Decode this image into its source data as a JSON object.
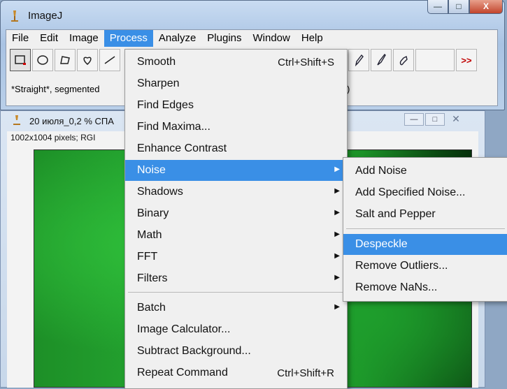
{
  "main_window": {
    "title": "ImageJ",
    "minimize": "—",
    "maximize": "□",
    "close": "X"
  },
  "menubar": [
    "File",
    "Edit",
    "Image",
    "Process",
    "Analyze",
    "Plugins",
    "Window",
    "Help"
  ],
  "toolbar": {
    "tools_left": [
      "rectangle",
      "oval",
      "polygon",
      "freehand",
      "line"
    ],
    "tools_right": [
      "pencil",
      "brush",
      "dropper"
    ],
    "more": ">>"
  },
  "status": {
    "text": "*Straight*, segmented",
    "text_right": ")"
  },
  "image_window": {
    "title": "20 июля_0,2 % СПА",
    "info": "1002x1004 pixels; RGI",
    "minimize": "—",
    "maximize": "□",
    "close": "✕"
  },
  "process_menu": {
    "items": [
      {
        "label": "Smooth",
        "shortcut": "Ctrl+Shift+S"
      },
      {
        "label": "Sharpen",
        "shortcut": ""
      },
      {
        "label": "Find Edges",
        "shortcut": ""
      },
      {
        "label": "Find Maxima...",
        "shortcut": ""
      },
      {
        "label": "Enhance Contrast",
        "shortcut": ""
      },
      {
        "label": "Noise",
        "shortcut": "",
        "submenu": true
      },
      {
        "label": "Shadows",
        "shortcut": "",
        "submenu": true
      },
      {
        "label": "Binary",
        "shortcut": "",
        "submenu": true
      },
      {
        "label": "Math",
        "shortcut": "",
        "submenu": true
      },
      {
        "label": "FFT",
        "shortcut": "",
        "submenu": true
      },
      {
        "label": "Filters",
        "shortcut": "",
        "submenu": true
      },
      {
        "label": "Batch",
        "shortcut": "",
        "submenu": true
      },
      {
        "label": "Image Calculator...",
        "shortcut": ""
      },
      {
        "label": "Subtract Background...",
        "shortcut": ""
      },
      {
        "label": "Repeat Command",
        "shortcut": "Ctrl+Shift+R"
      }
    ]
  },
  "noise_menu": {
    "items": [
      {
        "label": "Add Noise"
      },
      {
        "label": "Add Specified Noise..."
      },
      {
        "label": "Salt and Pepper"
      },
      {
        "label": "Despeckle"
      },
      {
        "label": "Remove Outliers..."
      },
      {
        "label": "Remove NaNs..."
      }
    ]
  },
  "colors": {
    "highlight": "#3a8fe6"
  }
}
